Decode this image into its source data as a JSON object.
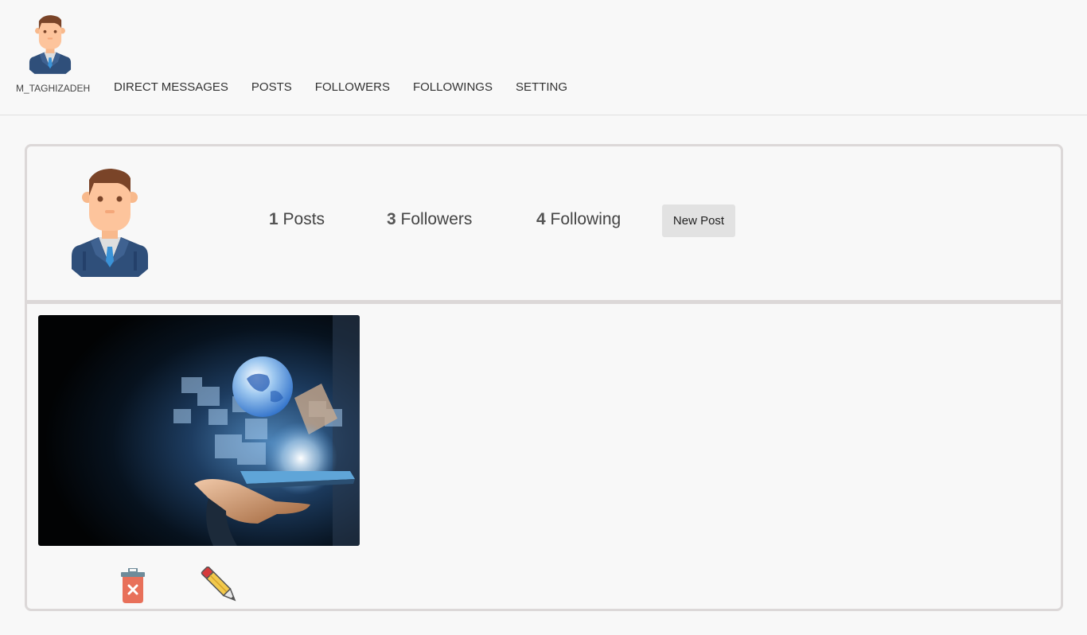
{
  "user": {
    "username": "M_TAGHIZADEH"
  },
  "nav": {
    "links": [
      {
        "label": "DIRECT MESSAGES"
      },
      {
        "label": "POSTS"
      },
      {
        "label": "FOLLOWERS"
      },
      {
        "label": "FOLLOWINGS"
      },
      {
        "label": "SETTING"
      }
    ]
  },
  "profile": {
    "stats": {
      "posts_count": "1",
      "posts_label": "Posts",
      "followers_count": "3",
      "followers_label": "Followers",
      "following_count": "4",
      "following_label": "Following"
    },
    "new_post_label": "New Post"
  },
  "posts": [
    {
      "image_icon": "technology-hand-tablet-globe-image",
      "actions": {
        "delete_icon": "trash-icon",
        "edit_icon": "pencil-icon"
      }
    }
  ],
  "colors": {
    "background": "#f8f8f8",
    "card_border": "#dcd8d8",
    "button_bg": "#e2e2e2",
    "trash_red": "#e8705a",
    "trash_lid": "#6e8b9a",
    "pencil_yellow": "#f2c94c",
    "pencil_red": "#d63b3b"
  }
}
